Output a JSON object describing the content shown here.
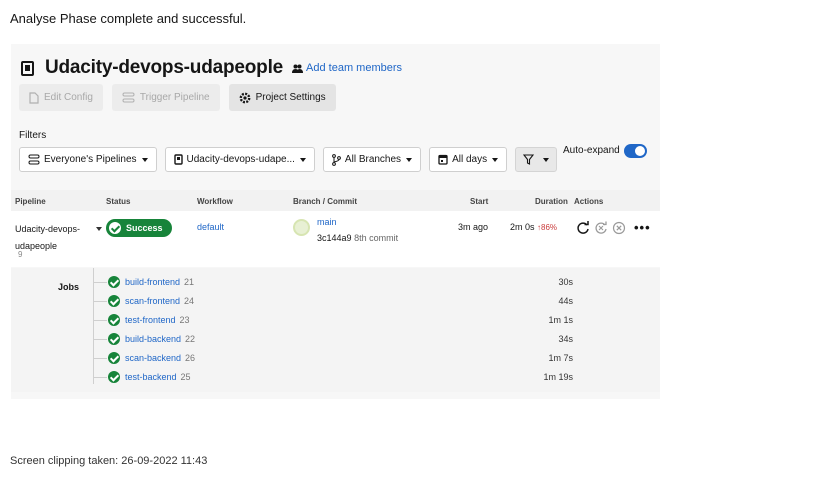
{
  "notes": {
    "top": "Analyse Phase complete and successful.",
    "bottom": "Screen clipping taken: 26-09-2022 11:43"
  },
  "project": {
    "title": "Udacity-devops-udapeople",
    "add_team": "Add team members"
  },
  "toolbar": {
    "edit_config": "Edit Config",
    "trigger_pipeline": "Trigger Pipeline",
    "project_settings": "Project Settings"
  },
  "filters": {
    "label": "Filters",
    "pipelines": "Everyone's Pipelines",
    "project": "Udacity-devops-udape...",
    "branches": "All Branches",
    "days": "All days",
    "auto_expand": "Auto-expand",
    "auto_expand_on": true
  },
  "table": {
    "headers": {
      "pipeline": "Pipeline",
      "status": "Status",
      "workflow": "Workflow",
      "branch": "Branch / Commit",
      "start": "Start",
      "duration": "Duration",
      "actions": "Actions"
    },
    "row": {
      "pipeline_line1": "Udacity-devops-",
      "pipeline_line2": "udapeople",
      "number": "9",
      "status": "Success",
      "workflow": "default",
      "branch": "main",
      "commit": "3c144a9",
      "commit_suffix": "8th commit",
      "start": "3m ago",
      "duration": "2m 0s",
      "change": "86%"
    }
  },
  "jobs": {
    "label": "Jobs",
    "items": [
      {
        "name": "build-frontend",
        "num": "21",
        "duration": "30s"
      },
      {
        "name": "scan-frontend",
        "num": "24",
        "duration": "44s"
      },
      {
        "name": "test-frontend",
        "num": "23",
        "duration": "1m 1s"
      },
      {
        "name": "build-backend",
        "num": "22",
        "duration": "34s"
      },
      {
        "name": "scan-backend",
        "num": "26",
        "duration": "1m 7s"
      },
      {
        "name": "test-backend",
        "num": "25",
        "duration": "1m 19s"
      }
    ]
  },
  "colors": {
    "accent": "#2067c7",
    "success": "#17843a",
    "increase": "#c93b3b"
  },
  "icons": [
    "bookmark-icon",
    "people-icon",
    "file-icon",
    "pipeline-icon",
    "gear-icon",
    "branch-icon",
    "calendar-icon",
    "filter-icon",
    "rerun-icon",
    "rerun-failed-icon",
    "cancel-icon",
    "more-icon",
    "check-icon"
  ]
}
